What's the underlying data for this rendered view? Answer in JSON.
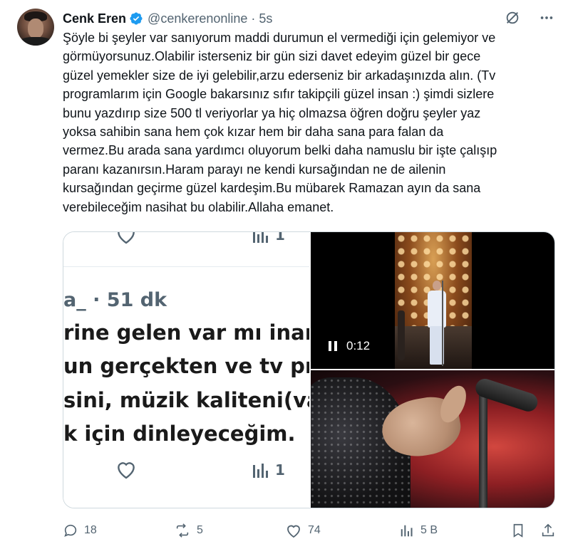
{
  "author": {
    "name": "Cenk Eren",
    "handle": "@cenkerenonline",
    "separator": "·",
    "time": "5s",
    "verified": true
  },
  "colors": {
    "verified_badge": "#1d9bf0",
    "secondary_text": "#536471",
    "primary_text": "#0f1419",
    "border": "#cfd9de"
  },
  "tweet": {
    "text_lines": [
      "Şöyle bi şeyler var sanıyorum maddi durumun el vermediği için gelemiyor ve",
      "görmüyorsunuz.Olabilir isterseniz bir gün sizi davet edeyim güzel bir gece",
      "güzel yemekler size de iyi gelebilir,arzu ederseniz bir arkadaşınızda alın. (Tv",
      "programlarım için Google bakarsınız sıfır takipçili güzel insan :) şimdi sizlere",
      "bunu yazdırıp size 500 tl veriyorlar ya hiç olmazsa öğren doğru şeyler yaz",
      "yoksa sahibin sana hem çok kızar hem bir daha sana para falan da",
      "vermez.Bu arada sana yardımcı oluyorum belki daha namuslu bir işte çalışıp",
      "paranı kazanırsın.Haram parayı ne kendi kursağından ne de ailenin",
      "kursağından geçirme güzel kardeşim.Bu mübarek Ramazan ayın da sana",
      "verebileceğim nasihat bu olabilir.Allaha emanet."
    ]
  },
  "media": {
    "screenshot": {
      "top_views": "1",
      "meta": "a_ · 51 dk",
      "line1": "rine gelen var mı inan",
      "line2": "un gerçekten ve tv pro",
      "line3": "sini, müzik kaliteni(va",
      "line4": "k için dinleyeceğim.",
      "bottom_views": "1"
    },
    "video": {
      "duration": "0:12",
      "state_icon": "pause-icon"
    },
    "photo": {
      "description_icon": "photo"
    }
  },
  "actions": {
    "replies": "18",
    "reposts": "5",
    "likes": "74",
    "views": "5 B"
  },
  "icons": {
    "top_right": [
      "grok-icon",
      "more-icon"
    ],
    "action_bar": [
      "reply-icon",
      "repost-icon",
      "like-icon",
      "views-icon",
      "bookmark-icon",
      "share-icon"
    ]
  }
}
